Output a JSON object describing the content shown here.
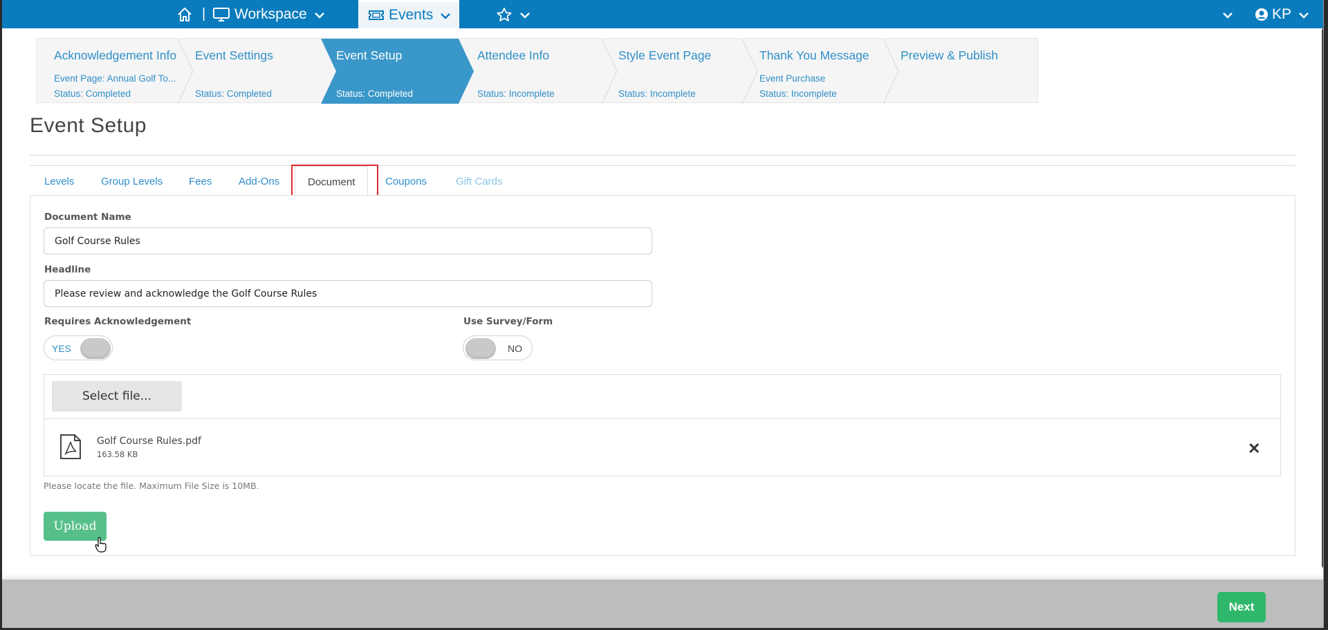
{
  "topnav": {
    "workspace_label": "Workspace",
    "separator": "|",
    "events_label": "Events",
    "user_initials": "KP"
  },
  "stepper": [
    {
      "title": "Acknowledgement Info",
      "sub": "Event Page: Annual Golf To...",
      "status": "Status: Completed"
    },
    {
      "title": "Event Settings",
      "sub": "",
      "status": "Status: Completed"
    },
    {
      "title": "Event Setup",
      "sub": "",
      "status": "Status: Completed"
    },
    {
      "title": "Attendee Info",
      "sub": "",
      "status": "Status: Incomplete"
    },
    {
      "title": "Style Event Page",
      "sub": "",
      "status": "Status: Incomplete"
    },
    {
      "title": "Thank You Message",
      "sub": "Event Purchase",
      "status": "Status: Incomplete"
    },
    {
      "title": "Preview & Publish",
      "sub": "",
      "status": ""
    }
  ],
  "page": {
    "title": "Event Setup"
  },
  "tabs": [
    "Levels",
    "Group Levels",
    "Fees",
    "Add-Ons",
    "Document",
    "Coupons",
    "Gift Cards"
  ],
  "form": {
    "document_name_label": "Document Name",
    "document_name_value": "Golf Course Rules",
    "headline_label": "Headline",
    "headline_value": "Please review and acknowledge the Golf Course Rules",
    "requires_ack_label": "Requires Acknowledgement",
    "requires_ack_state": "YES",
    "survey_label": "Use Survey/Form",
    "survey_state": "NO"
  },
  "upload": {
    "select_label": "Select file...",
    "file_name": "Golf Course Rules.pdf",
    "file_size": "163.58 KB",
    "remove_symbol": "✕",
    "hint": "Please locate the file. Maximum File Size is 10MB.",
    "upload_label": "Upload"
  },
  "footer": {
    "next_label": "Next"
  },
  "colors": {
    "nav_blue": "#0a7bbd",
    "link_blue": "#2f8fc8",
    "active_step": "#3a97c9",
    "upload_green": "#57c08a",
    "next_green": "#2fb86b",
    "highlight_red": "#e02b2b"
  }
}
